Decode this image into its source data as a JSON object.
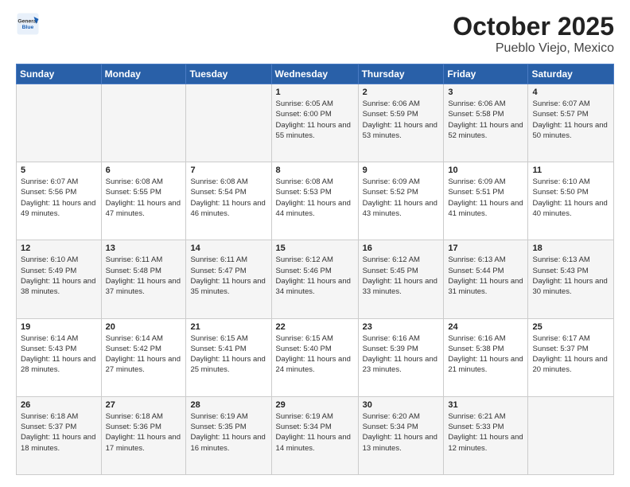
{
  "header": {
    "logo_line1": "General",
    "logo_line2": "Blue",
    "title": "October 2025",
    "subtitle": "Pueblo Viejo, Mexico"
  },
  "days_of_week": [
    "Sunday",
    "Monday",
    "Tuesday",
    "Wednesday",
    "Thursday",
    "Friday",
    "Saturday"
  ],
  "weeks": [
    [
      {
        "num": "",
        "sunrise": "",
        "sunset": "",
        "daylight": ""
      },
      {
        "num": "",
        "sunrise": "",
        "sunset": "",
        "daylight": ""
      },
      {
        "num": "",
        "sunrise": "",
        "sunset": "",
        "daylight": ""
      },
      {
        "num": "1",
        "sunrise": "Sunrise: 6:05 AM",
        "sunset": "Sunset: 6:00 PM",
        "daylight": "Daylight: 11 hours and 55 minutes."
      },
      {
        "num": "2",
        "sunrise": "Sunrise: 6:06 AM",
        "sunset": "Sunset: 5:59 PM",
        "daylight": "Daylight: 11 hours and 53 minutes."
      },
      {
        "num": "3",
        "sunrise": "Sunrise: 6:06 AM",
        "sunset": "Sunset: 5:58 PM",
        "daylight": "Daylight: 11 hours and 52 minutes."
      },
      {
        "num": "4",
        "sunrise": "Sunrise: 6:07 AM",
        "sunset": "Sunset: 5:57 PM",
        "daylight": "Daylight: 11 hours and 50 minutes."
      }
    ],
    [
      {
        "num": "5",
        "sunrise": "Sunrise: 6:07 AM",
        "sunset": "Sunset: 5:56 PM",
        "daylight": "Daylight: 11 hours and 49 minutes."
      },
      {
        "num": "6",
        "sunrise": "Sunrise: 6:08 AM",
        "sunset": "Sunset: 5:55 PM",
        "daylight": "Daylight: 11 hours and 47 minutes."
      },
      {
        "num": "7",
        "sunrise": "Sunrise: 6:08 AM",
        "sunset": "Sunset: 5:54 PM",
        "daylight": "Daylight: 11 hours and 46 minutes."
      },
      {
        "num": "8",
        "sunrise": "Sunrise: 6:08 AM",
        "sunset": "Sunset: 5:53 PM",
        "daylight": "Daylight: 11 hours and 44 minutes."
      },
      {
        "num": "9",
        "sunrise": "Sunrise: 6:09 AM",
        "sunset": "Sunset: 5:52 PM",
        "daylight": "Daylight: 11 hours and 43 minutes."
      },
      {
        "num": "10",
        "sunrise": "Sunrise: 6:09 AM",
        "sunset": "Sunset: 5:51 PM",
        "daylight": "Daylight: 11 hours and 41 minutes."
      },
      {
        "num": "11",
        "sunrise": "Sunrise: 6:10 AM",
        "sunset": "Sunset: 5:50 PM",
        "daylight": "Daylight: 11 hours and 40 minutes."
      }
    ],
    [
      {
        "num": "12",
        "sunrise": "Sunrise: 6:10 AM",
        "sunset": "Sunset: 5:49 PM",
        "daylight": "Daylight: 11 hours and 38 minutes."
      },
      {
        "num": "13",
        "sunrise": "Sunrise: 6:11 AM",
        "sunset": "Sunset: 5:48 PM",
        "daylight": "Daylight: 11 hours and 37 minutes."
      },
      {
        "num": "14",
        "sunrise": "Sunrise: 6:11 AM",
        "sunset": "Sunset: 5:47 PM",
        "daylight": "Daylight: 11 hours and 35 minutes."
      },
      {
        "num": "15",
        "sunrise": "Sunrise: 6:12 AM",
        "sunset": "Sunset: 5:46 PM",
        "daylight": "Daylight: 11 hours and 34 minutes."
      },
      {
        "num": "16",
        "sunrise": "Sunrise: 6:12 AM",
        "sunset": "Sunset: 5:45 PM",
        "daylight": "Daylight: 11 hours and 33 minutes."
      },
      {
        "num": "17",
        "sunrise": "Sunrise: 6:13 AM",
        "sunset": "Sunset: 5:44 PM",
        "daylight": "Daylight: 11 hours and 31 minutes."
      },
      {
        "num": "18",
        "sunrise": "Sunrise: 6:13 AM",
        "sunset": "Sunset: 5:43 PM",
        "daylight": "Daylight: 11 hours and 30 minutes."
      }
    ],
    [
      {
        "num": "19",
        "sunrise": "Sunrise: 6:14 AM",
        "sunset": "Sunset: 5:43 PM",
        "daylight": "Daylight: 11 hours and 28 minutes."
      },
      {
        "num": "20",
        "sunrise": "Sunrise: 6:14 AM",
        "sunset": "Sunset: 5:42 PM",
        "daylight": "Daylight: 11 hours and 27 minutes."
      },
      {
        "num": "21",
        "sunrise": "Sunrise: 6:15 AM",
        "sunset": "Sunset: 5:41 PM",
        "daylight": "Daylight: 11 hours and 25 minutes."
      },
      {
        "num": "22",
        "sunrise": "Sunrise: 6:15 AM",
        "sunset": "Sunset: 5:40 PM",
        "daylight": "Daylight: 11 hours and 24 minutes."
      },
      {
        "num": "23",
        "sunrise": "Sunrise: 6:16 AM",
        "sunset": "Sunset: 5:39 PM",
        "daylight": "Daylight: 11 hours and 23 minutes."
      },
      {
        "num": "24",
        "sunrise": "Sunrise: 6:16 AM",
        "sunset": "Sunset: 5:38 PM",
        "daylight": "Daylight: 11 hours and 21 minutes."
      },
      {
        "num": "25",
        "sunrise": "Sunrise: 6:17 AM",
        "sunset": "Sunset: 5:37 PM",
        "daylight": "Daylight: 11 hours and 20 minutes."
      }
    ],
    [
      {
        "num": "26",
        "sunrise": "Sunrise: 6:18 AM",
        "sunset": "Sunset: 5:37 PM",
        "daylight": "Daylight: 11 hours and 18 minutes."
      },
      {
        "num": "27",
        "sunrise": "Sunrise: 6:18 AM",
        "sunset": "Sunset: 5:36 PM",
        "daylight": "Daylight: 11 hours and 17 minutes."
      },
      {
        "num": "28",
        "sunrise": "Sunrise: 6:19 AM",
        "sunset": "Sunset: 5:35 PM",
        "daylight": "Daylight: 11 hours and 16 minutes."
      },
      {
        "num": "29",
        "sunrise": "Sunrise: 6:19 AM",
        "sunset": "Sunset: 5:34 PM",
        "daylight": "Daylight: 11 hours and 14 minutes."
      },
      {
        "num": "30",
        "sunrise": "Sunrise: 6:20 AM",
        "sunset": "Sunset: 5:34 PM",
        "daylight": "Daylight: 11 hours and 13 minutes."
      },
      {
        "num": "31",
        "sunrise": "Sunrise: 6:21 AM",
        "sunset": "Sunset: 5:33 PM",
        "daylight": "Daylight: 11 hours and 12 minutes."
      },
      {
        "num": "",
        "sunrise": "",
        "sunset": "",
        "daylight": ""
      }
    ]
  ]
}
